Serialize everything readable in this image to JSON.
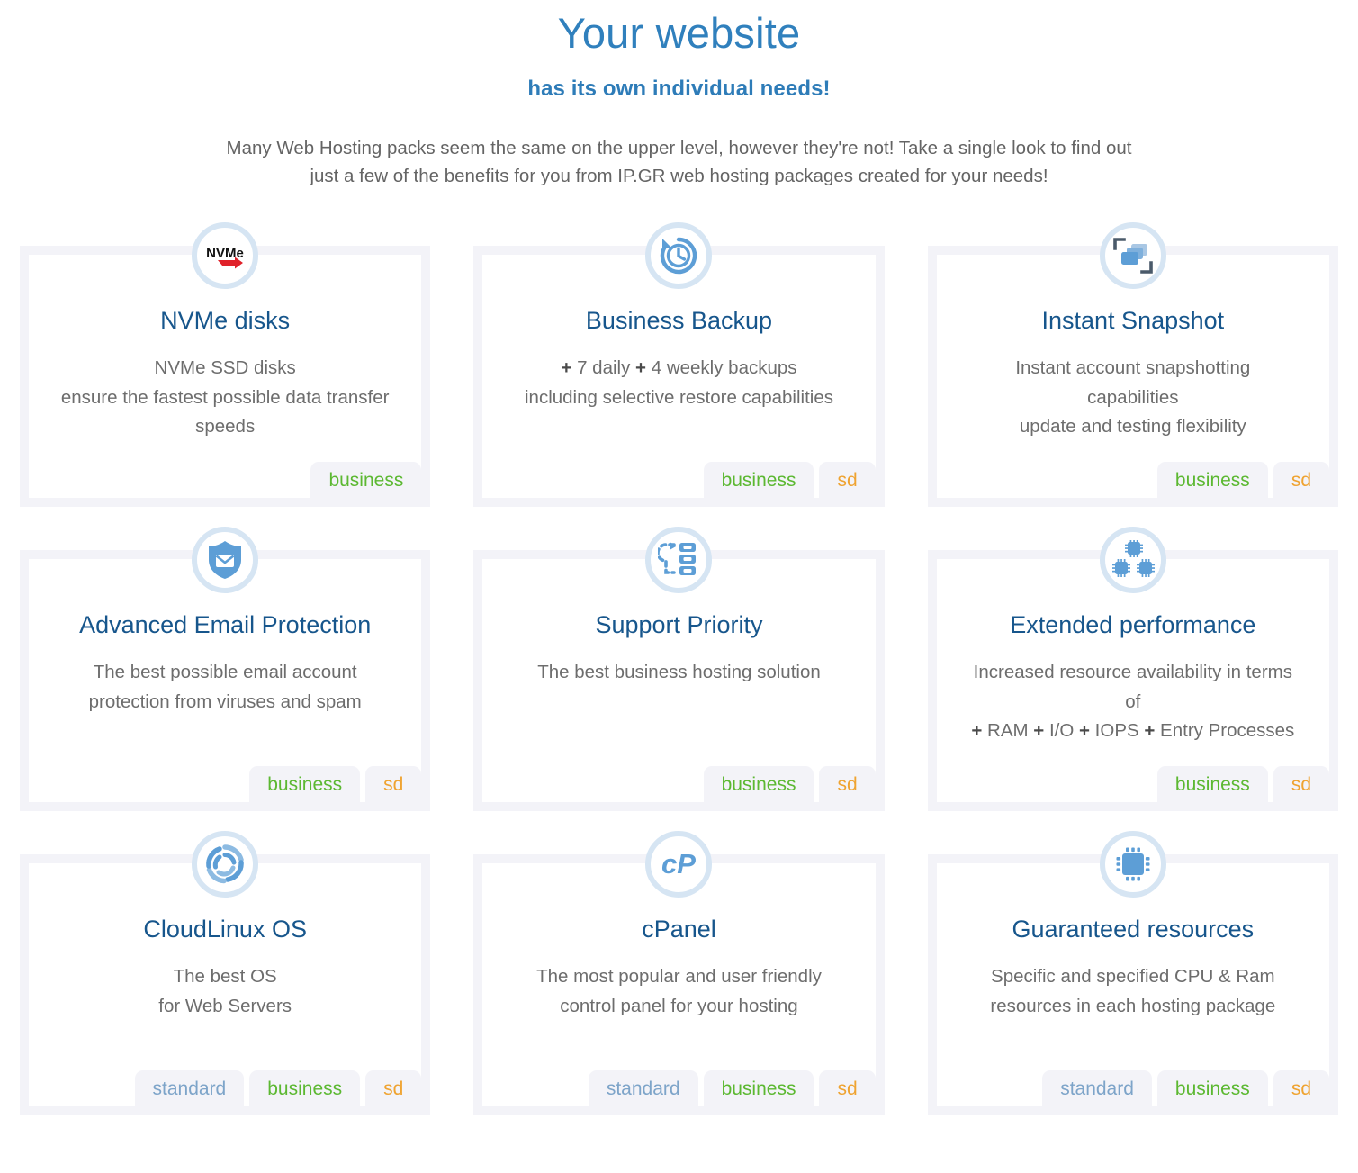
{
  "header": {
    "title": "Your website",
    "subtitle": "has its own individual needs!",
    "intro_line_1": "Many Web Hosting packs seem the same on the upper level, however they're not! Take a single look to find out",
    "intro_line_2": "just a few of the benefits for you from IP.GR web hosting packages created for your needs!"
  },
  "colors": {
    "heading_blue": "#3080bd",
    "subheading_blue": "#2e7cb8",
    "card_title_blue": "#17568c",
    "body_gray": "#6d6d6d",
    "panel_gray": "#f3f3f8",
    "icon_ring_blue": "#d6e5f3",
    "icon_blue": "#5d9ed6",
    "badge_standard": "#7da4c9",
    "badge_business": "#5cb832",
    "badge_sd": "#efa331",
    "nvme_red": "#e0212a"
  },
  "badge_labels": {
    "standard": "standard",
    "business": "business",
    "sd": "sd"
  },
  "features": [
    {
      "icon": "nvme-logo-icon",
      "title": "NVMe disks",
      "desc_lines": [
        "NVMe SSD disks",
        "ensure the fastest possible data transfer",
        "speeds"
      ],
      "badges": [
        "business"
      ]
    },
    {
      "icon": "backup-history-clock-icon",
      "title": "Business Backup",
      "desc_lines": [
        "+ 7 daily + 4 weekly backups",
        "including selective restore capabilities"
      ],
      "badges": [
        "business",
        "sd"
      ]
    },
    {
      "icon": "snapshot-frame-icon",
      "title": "Instant Snapshot",
      "desc_lines": [
        "Instant account snapshotting",
        "capabilities",
        "update and testing flexibility"
      ],
      "badges": [
        "business",
        "sd"
      ]
    },
    {
      "icon": "shield-envelope-icon",
      "title": "Advanced Email Protection",
      "desc_lines": [
        "The best possible email account",
        "protection from viruses and spam"
      ],
      "badges": [
        "business",
        "sd"
      ]
    },
    {
      "icon": "priority-queue-arrow-icon",
      "title": "Support Priority",
      "desc_lines": [
        "The best business hosting solution"
      ],
      "badges": [
        "business",
        "sd"
      ]
    },
    {
      "icon": "three-cpu-chips-icon",
      "title": "Extended performance",
      "desc_lines": [
        "Increased resource availability in terms",
        "of",
        "+ RAM  + I/O  + IOPS  + Entry Processes"
      ],
      "badges": [
        "business",
        "sd"
      ]
    },
    {
      "icon": "cloudlinux-swirl-icon",
      "title": "CloudLinux OS",
      "desc_lines": [
        "The best OS",
        "for Web Servers"
      ],
      "badges": [
        "standard",
        "business",
        "sd"
      ]
    },
    {
      "icon": "cpanel-logo-icon",
      "title": "cPanel",
      "desc_lines": [
        "The most popular and user friendly",
        "control panel for your hosting"
      ],
      "badges": [
        "standard",
        "business",
        "sd"
      ]
    },
    {
      "icon": "cpu-chip-icon",
      "title": "Guaranteed resources",
      "desc_lines": [
        "Specific and specified CPU & Ram",
        "resources in each hosting package"
      ],
      "badges": [
        "standard",
        "business",
        "sd"
      ]
    }
  ]
}
